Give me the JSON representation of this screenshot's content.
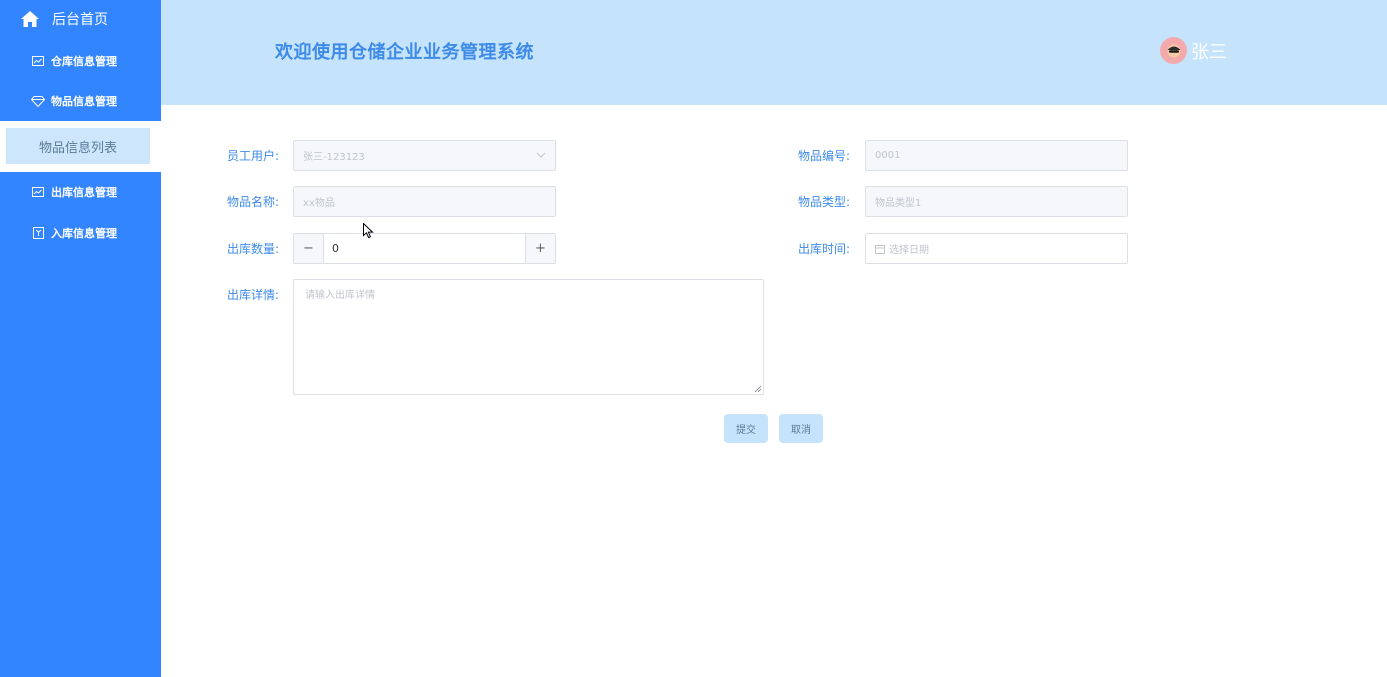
{
  "sidebar": {
    "home": "后台首页",
    "menus": [
      {
        "label": "仓库信息管理",
        "icon": "chart-icon"
      },
      {
        "label": "物品信息管理",
        "icon": "diamond-icon"
      },
      {
        "label": "出库信息管理",
        "icon": "chart-icon"
      },
      {
        "label": "入库信息管理",
        "icon": "bookmark-icon"
      }
    ],
    "sub_item": "物品信息列表"
  },
  "header": {
    "title": "欢迎使用仓储企业业务管理系统",
    "username": "张三"
  },
  "form": {
    "employee_label": "员工用户:",
    "employee_value": "张三-123123",
    "item_no_label": "物品编号:",
    "item_no_value": "0001",
    "item_name_label": "物品名称:",
    "item_name_value": "xx物品",
    "item_type_label": "物品类型:",
    "item_type_value": "物品类型1",
    "qty_label": "出库数量:",
    "qty_value": "0",
    "qty_minus": "−",
    "qty_plus": "+",
    "time_label": "出库时间:",
    "time_placeholder": "选择日期",
    "detail_label": "出库详情:",
    "detail_placeholder": "请输入出库详情",
    "submit": "提交",
    "cancel": "取消"
  },
  "colors": {
    "sidebar": "#3385ff",
    "header": "#c5e4fc",
    "accent": "#3d8ae8"
  }
}
